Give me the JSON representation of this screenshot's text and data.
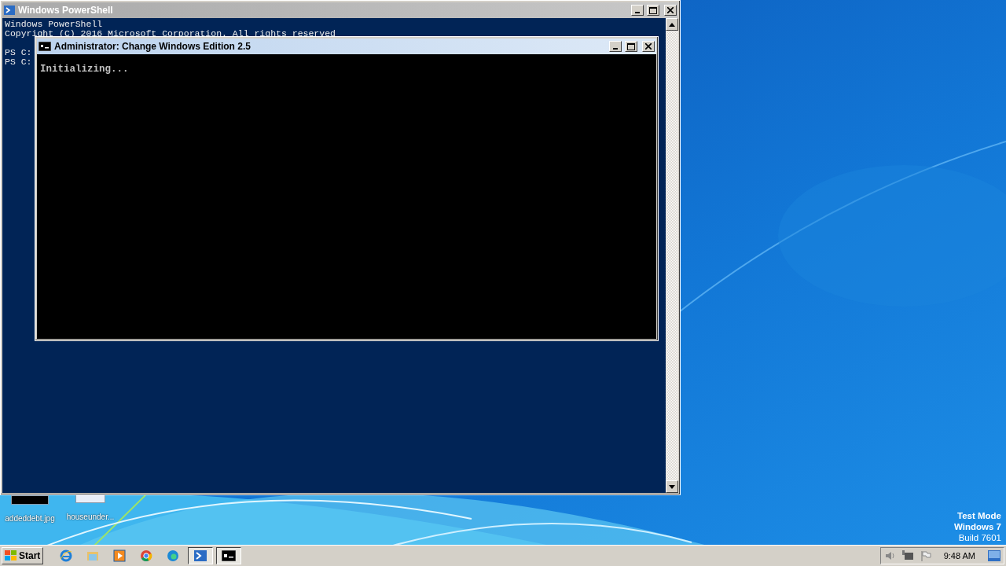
{
  "powershell_window": {
    "title": "Windows PowerShell",
    "lines": [
      "Windows PowerShell",
      "Copyright (C) 2016 Microsoft Corporation. All rights reserved"
    ],
    "prompts": [
      "PS C:",
      "PS C:"
    ]
  },
  "console_window": {
    "title": "Administrator:  Change Windows Edition 2.5",
    "output": "Initializing..."
  },
  "desktop_icons": [
    {
      "label": "addeddebt.jpg",
      "kind": "dark"
    },
    {
      "label": "houseunder...",
      "kind": "light"
    }
  ],
  "os_notice": [
    "Test Mode",
    "Windows 7",
    "Build 7601"
  ],
  "taskbar": {
    "start": "Start",
    "apps": [
      {
        "kind": "ie",
        "selected": false
      },
      {
        "kind": "folder",
        "selected": false
      },
      {
        "kind": "media",
        "selected": false
      },
      {
        "kind": "chrome",
        "selected": false
      },
      {
        "kind": "edge",
        "selected": false
      },
      {
        "kind": "powershell",
        "selected": true
      },
      {
        "kind": "cmd",
        "selected": true
      }
    ],
    "clock": "9:48 AM"
  }
}
